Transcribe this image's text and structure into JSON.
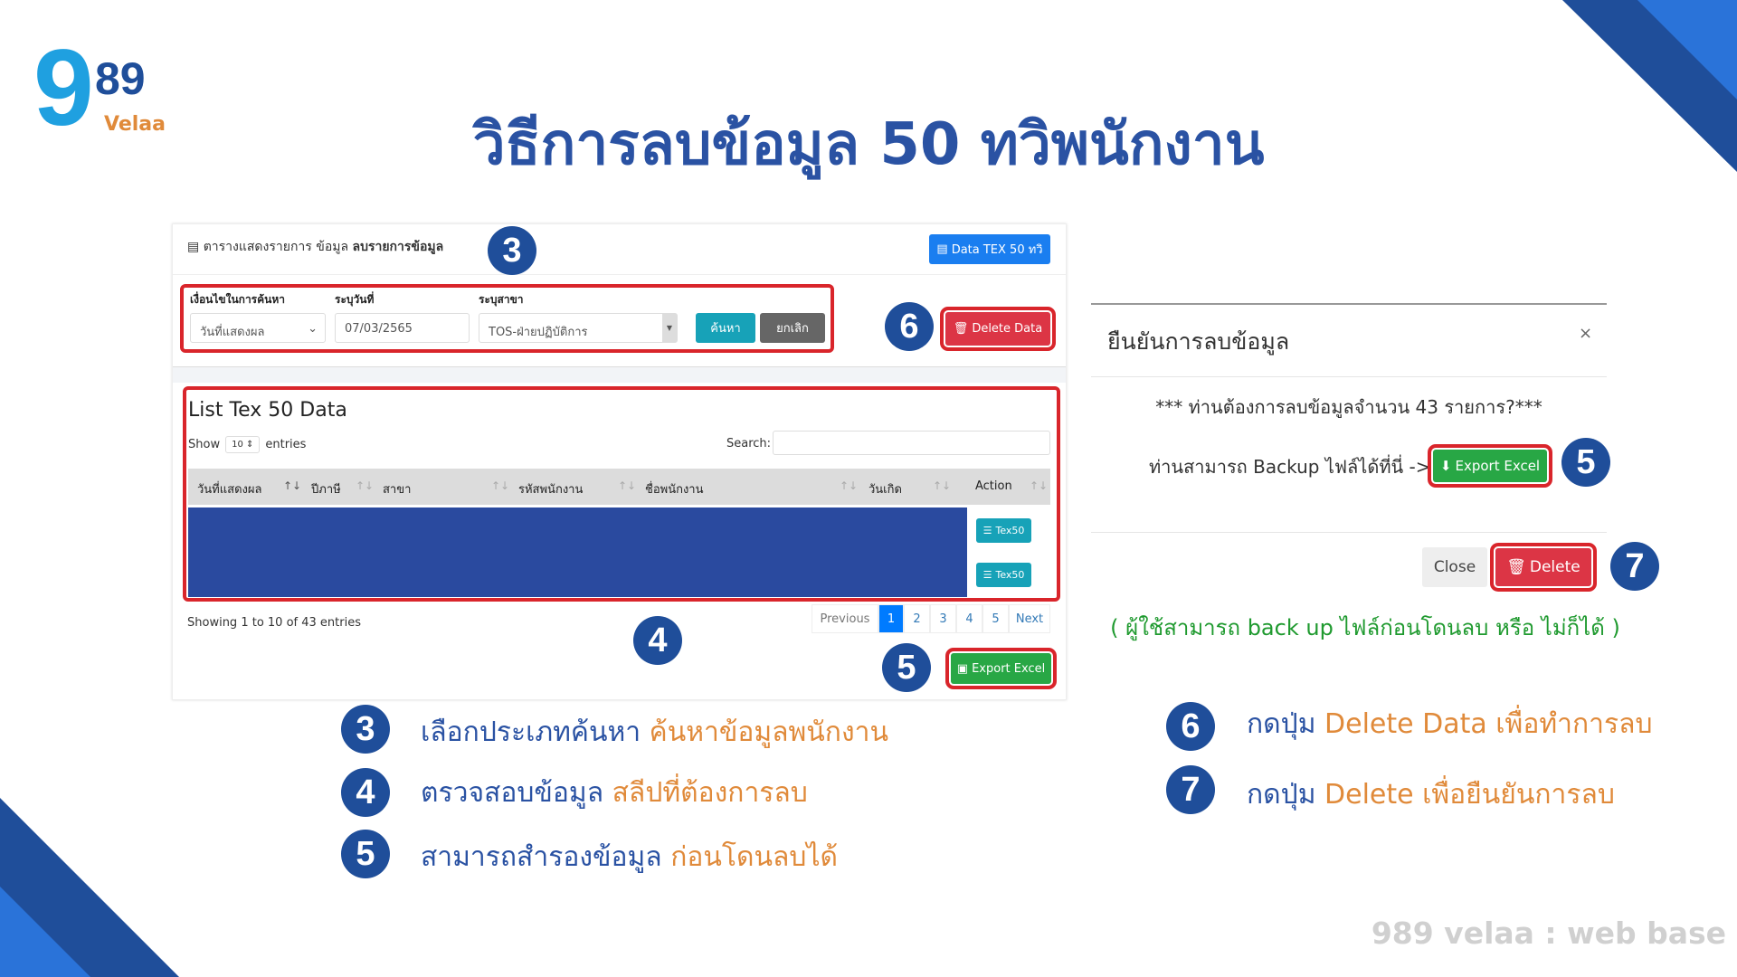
{
  "logo": {
    "big": "9",
    "small": "89",
    "sub": "Velaa"
  },
  "title": "วิธีการลบข้อมูล 50 ทวิพนักงาน",
  "panel": {
    "header": "ตารางแสดงรายการ ข้อมูล",
    "header_bold": "ลบรายการข้อมูล",
    "data_tex_btn": "Data TEX 50 ทวิ",
    "filter": {
      "cond_label": "เงื่อนไขในการค้นหา",
      "date_label": "ระบุวันที่",
      "branch_label": "ระบุสาขา",
      "cond_value": "วันที่แสดงผล",
      "date_value": "07/03/2565",
      "branch_value": "TOS-ฝ่ายปฏิบัติการ",
      "search_btn": "ค้นหา",
      "cancel_btn": "ยกเลิก"
    },
    "delete_data_btn": "Delete Data",
    "list_title": "List Tex 50 Data",
    "show": "Show",
    "entries_value": "10",
    "entries": "entries",
    "search_label": "Search:",
    "columns": [
      "วันที่แสดงผล",
      "ปีภาษี",
      "สาขา",
      "รหัสพนักงาน",
      "ชื่อพนักงาน",
      "วันเกิด",
      "Action"
    ],
    "row_btn": "Tex50",
    "showing": "Showing 1 to 10 of 43 entries",
    "pagination": [
      "Previous",
      "1",
      "2",
      "3",
      "4",
      "5",
      "Next"
    ],
    "export_btn": "Export Excel"
  },
  "modal": {
    "title": "ยืนยันการลบข้อมูล",
    "close_x": "×",
    "message": "*** ท่านต้องการลบข้อมูลจำนวน 43 รายการ?***",
    "backup": "ท่านสามารถ Backup ไฟล์ได้ที่นี่ ->",
    "export_btn": "Export Excel",
    "close_btn": "Close",
    "delete_btn": "Delete"
  },
  "note": "( ผู้ใช้สามารถ back up ไฟล์ก่อนโดนลบ หรือ ไม่ก็ได้ )",
  "steps": [
    {
      "n": "3",
      "a": "เลือกประเภทค้นหา",
      "b": "ค้นหาข้อมูลพนักงาน"
    },
    {
      "n": "4",
      "a": "ตรวจสอบข้อมูล",
      "b": "สลีปที่ต้องการลบ"
    },
    {
      "n": "5",
      "a": "สามารถสำรองข้อมูล",
      "b": "ก่อนโดนลบได้"
    },
    {
      "n": "6",
      "a": "กดปุ่ม",
      "b": "Delete Data เพื่อทำการลบ"
    },
    {
      "n": "7",
      "a": "กดปุ่ม",
      "b": "Delete เพื่อยืนยันการลบ"
    }
  ],
  "footer": "989 velaa : web base",
  "colors": {
    "title": "#2a52a3",
    "accent": "#e08a3a",
    "highlight": "#d9252b",
    "danger": "#dc3545",
    "success": "#28a745",
    "info": "#17a2b8",
    "primary": "#007bff"
  }
}
